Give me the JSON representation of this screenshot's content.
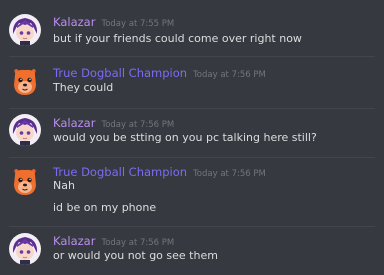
{
  "users": {
    "kalazar": {
      "name": "Kalazar",
      "color": "#b98ef0"
    },
    "champion": {
      "name": "True Dogball Champion",
      "color": "#7b6cf5"
    }
  },
  "messages": [
    {
      "author": "Kalazar",
      "timestamp": "Today at 7:55 PM",
      "lines": [
        "but if your friends could come over right now"
      ]
    },
    {
      "author": "True Dogball Champion",
      "timestamp": "Today at 7:56 PM",
      "lines": [
        "They could"
      ]
    },
    {
      "author": "Kalazar",
      "timestamp": "Today at 7:56 PM",
      "lines": [
        "would you be stting on you pc talking here still?"
      ]
    },
    {
      "author": "True Dogball Champion",
      "timestamp": "Today at 7:56 PM",
      "lines": [
        "Nah",
        "id be on my phone"
      ]
    },
    {
      "author": "Kalazar",
      "timestamp": "Today at 7:56 PM",
      "lines": [
        "or would you not go see them"
      ]
    }
  ]
}
